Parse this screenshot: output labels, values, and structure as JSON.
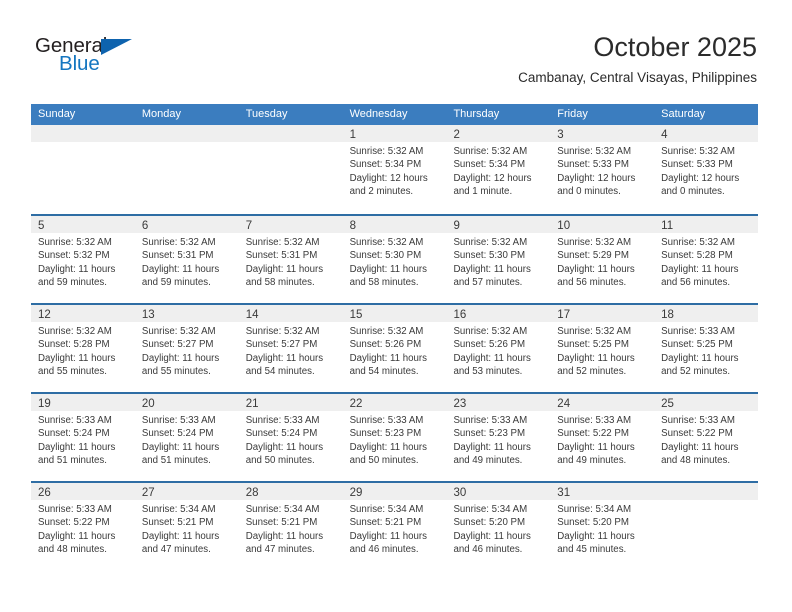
{
  "brand": {
    "name_top": "General",
    "name_bottom": "Blue",
    "triangle_icon": "blue-triangle-icon",
    "accent_color": "#1476c0",
    "dark_color": "#231f20"
  },
  "header": {
    "title": "October 2025",
    "subtitle": "Cambanay, Central Visayas, Philippines"
  },
  "colors": {
    "header_blue": "#3b7dbf",
    "row_divider_blue": "#2e6da4",
    "daynum_strip_gray": "#efefef",
    "text": "#3a3a3a"
  },
  "weekdays": [
    "Sunday",
    "Monday",
    "Tuesday",
    "Wednesday",
    "Thursday",
    "Friday",
    "Saturday"
  ],
  "labels": {
    "sunrise_prefix": "Sunrise:",
    "sunset_prefix": "Sunset:",
    "daylight_prefix": "Daylight:"
  },
  "weeks": [
    [
      {
        "day": "",
        "lines": []
      },
      {
        "day": "",
        "lines": []
      },
      {
        "day": "",
        "lines": []
      },
      {
        "day": "1",
        "lines": [
          "Sunrise: 5:32 AM",
          "Sunset: 5:34 PM",
          "Daylight: 12 hours and 2 minutes."
        ]
      },
      {
        "day": "2",
        "lines": [
          "Sunrise: 5:32 AM",
          "Sunset: 5:34 PM",
          "Daylight: 12 hours and 1 minute."
        ]
      },
      {
        "day": "3",
        "lines": [
          "Sunrise: 5:32 AM",
          "Sunset: 5:33 PM",
          "Daylight: 12 hours and 0 minutes."
        ]
      },
      {
        "day": "4",
        "lines": [
          "Sunrise: 5:32 AM",
          "Sunset: 5:33 PM",
          "Daylight: 12 hours and 0 minutes."
        ]
      }
    ],
    [
      {
        "day": "5",
        "lines": [
          "Sunrise: 5:32 AM",
          "Sunset: 5:32 PM",
          "Daylight: 11 hours and 59 minutes."
        ]
      },
      {
        "day": "6",
        "lines": [
          "Sunrise: 5:32 AM",
          "Sunset: 5:31 PM",
          "Daylight: 11 hours and 59 minutes."
        ]
      },
      {
        "day": "7",
        "lines": [
          "Sunrise: 5:32 AM",
          "Sunset: 5:31 PM",
          "Daylight: 11 hours and 58 minutes."
        ]
      },
      {
        "day": "8",
        "lines": [
          "Sunrise: 5:32 AM",
          "Sunset: 5:30 PM",
          "Daylight: 11 hours and 58 minutes."
        ]
      },
      {
        "day": "9",
        "lines": [
          "Sunrise: 5:32 AM",
          "Sunset: 5:30 PM",
          "Daylight: 11 hours and 57 minutes."
        ]
      },
      {
        "day": "10",
        "lines": [
          "Sunrise: 5:32 AM",
          "Sunset: 5:29 PM",
          "Daylight: 11 hours and 56 minutes."
        ]
      },
      {
        "day": "11",
        "lines": [
          "Sunrise: 5:32 AM",
          "Sunset: 5:28 PM",
          "Daylight: 11 hours and 56 minutes."
        ]
      }
    ],
    [
      {
        "day": "12",
        "lines": [
          "Sunrise: 5:32 AM",
          "Sunset: 5:28 PM",
          "Daylight: 11 hours and 55 minutes."
        ]
      },
      {
        "day": "13",
        "lines": [
          "Sunrise: 5:32 AM",
          "Sunset: 5:27 PM",
          "Daylight: 11 hours and 55 minutes."
        ]
      },
      {
        "day": "14",
        "lines": [
          "Sunrise: 5:32 AM",
          "Sunset: 5:27 PM",
          "Daylight: 11 hours and 54 minutes."
        ]
      },
      {
        "day": "15",
        "lines": [
          "Sunrise: 5:32 AM",
          "Sunset: 5:26 PM",
          "Daylight: 11 hours and 54 minutes."
        ]
      },
      {
        "day": "16",
        "lines": [
          "Sunrise: 5:32 AM",
          "Sunset: 5:26 PM",
          "Daylight: 11 hours and 53 minutes."
        ]
      },
      {
        "day": "17",
        "lines": [
          "Sunrise: 5:32 AM",
          "Sunset: 5:25 PM",
          "Daylight: 11 hours and 52 minutes."
        ]
      },
      {
        "day": "18",
        "lines": [
          "Sunrise: 5:33 AM",
          "Sunset: 5:25 PM",
          "Daylight: 11 hours and 52 minutes."
        ]
      }
    ],
    [
      {
        "day": "19",
        "lines": [
          "Sunrise: 5:33 AM",
          "Sunset: 5:24 PM",
          "Daylight: 11 hours and 51 minutes."
        ]
      },
      {
        "day": "20",
        "lines": [
          "Sunrise: 5:33 AM",
          "Sunset: 5:24 PM",
          "Daylight: 11 hours and 51 minutes."
        ]
      },
      {
        "day": "21",
        "lines": [
          "Sunrise: 5:33 AM",
          "Sunset: 5:24 PM",
          "Daylight: 11 hours and 50 minutes."
        ]
      },
      {
        "day": "22",
        "lines": [
          "Sunrise: 5:33 AM",
          "Sunset: 5:23 PM",
          "Daylight: 11 hours and 50 minutes."
        ]
      },
      {
        "day": "23",
        "lines": [
          "Sunrise: 5:33 AM",
          "Sunset: 5:23 PM",
          "Daylight: 11 hours and 49 minutes."
        ]
      },
      {
        "day": "24",
        "lines": [
          "Sunrise: 5:33 AM",
          "Sunset: 5:22 PM",
          "Daylight: 11 hours and 49 minutes."
        ]
      },
      {
        "day": "25",
        "lines": [
          "Sunrise: 5:33 AM",
          "Sunset: 5:22 PM",
          "Daylight: 11 hours and 48 minutes."
        ]
      }
    ],
    [
      {
        "day": "26",
        "lines": [
          "Sunrise: 5:33 AM",
          "Sunset: 5:22 PM",
          "Daylight: 11 hours and 48 minutes."
        ]
      },
      {
        "day": "27",
        "lines": [
          "Sunrise: 5:34 AM",
          "Sunset: 5:21 PM",
          "Daylight: 11 hours and 47 minutes."
        ]
      },
      {
        "day": "28",
        "lines": [
          "Sunrise: 5:34 AM",
          "Sunset: 5:21 PM",
          "Daylight: 11 hours and 47 minutes."
        ]
      },
      {
        "day": "29",
        "lines": [
          "Sunrise: 5:34 AM",
          "Sunset: 5:21 PM",
          "Daylight: 11 hours and 46 minutes."
        ]
      },
      {
        "day": "30",
        "lines": [
          "Sunrise: 5:34 AM",
          "Sunset: 5:20 PM",
          "Daylight: 11 hours and 46 minutes."
        ]
      },
      {
        "day": "31",
        "lines": [
          "Sunrise: 5:34 AM",
          "Sunset: 5:20 PM",
          "Daylight: 11 hours and 45 minutes."
        ]
      },
      {
        "day": "",
        "lines": []
      }
    ]
  ]
}
